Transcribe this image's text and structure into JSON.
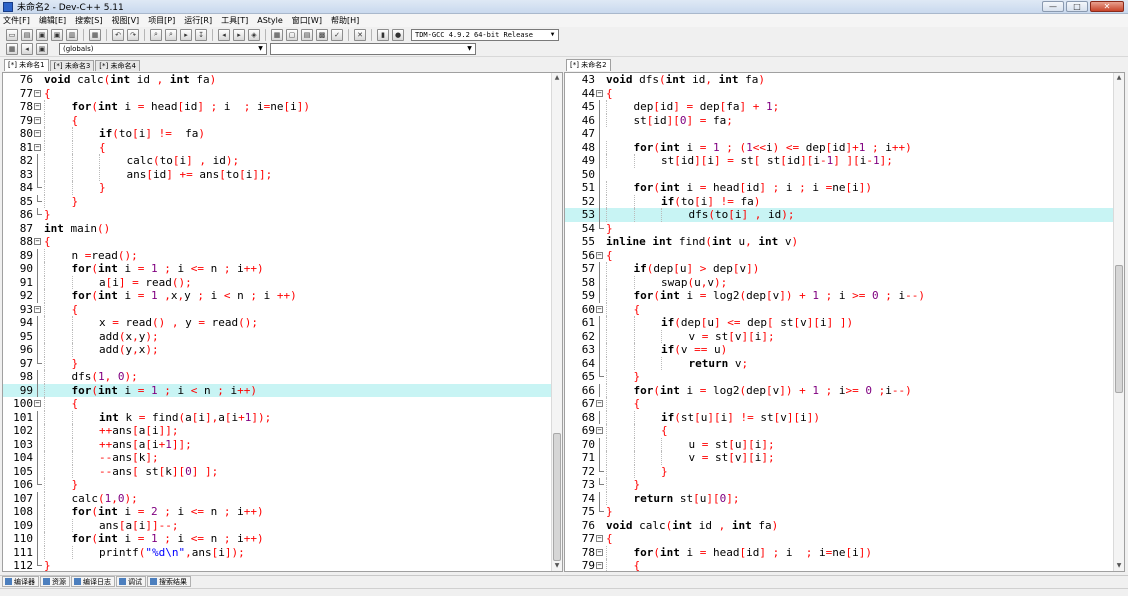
{
  "window": {
    "title": "未命名2 - Dev-C++ 5.11"
  },
  "window_buttons": {
    "minimize": "—",
    "maximize": "□",
    "close": "✕"
  },
  "menu": [
    "文件[F]",
    "编辑[E]",
    "搜索[S]",
    "视图[V]",
    "项目[P]",
    "运行[R]",
    "工具[T]",
    "AStyle",
    "窗口[W]",
    "帮助[H]"
  ],
  "toolbar": {
    "compiler": "TDM-GCC 4.9.2 64-bit Release",
    "scope": "(globals)"
  },
  "left_tabs": [
    "[*] 未命名1",
    "[*] 未命名3",
    "[*] 未命名4"
  ],
  "right_tabs": [
    "[*] 未命名2"
  ],
  "bottom_tabs": [
    "编译器",
    "资源",
    "编译日志",
    "调试",
    "搜索结果"
  ],
  "left_lines": [
    {
      "n": "76",
      "fold": "none",
      "code": "void calc(int id , int fa)",
      "kw": [
        "void",
        "int",
        "int"
      ]
    },
    {
      "n": "77",
      "fold": "open",
      "code": "{"
    },
    {
      "n": "78",
      "fold": "open",
      "code": "    for(int i = head[id] ; i  ; i=ne[i])"
    },
    {
      "n": "79",
      "fold": "open",
      "code": "    {"
    },
    {
      "n": "80",
      "fold": "open",
      "code": "        if(to[i] !=  fa)"
    },
    {
      "n": "81",
      "fold": "open",
      "code": "        {"
    },
    {
      "n": "82",
      "fold": "line",
      "code": "            calc(to[i] , id);"
    },
    {
      "n": "83",
      "fold": "line",
      "code": "            ans[id] += ans[to[i]];"
    },
    {
      "n": "84",
      "fold": "end",
      "code": "        }"
    },
    {
      "n": "85",
      "fold": "end",
      "code": "    }"
    },
    {
      "n": "86",
      "fold": "end",
      "code": "}"
    },
    {
      "n": "87",
      "fold": "none",
      "code": "int main()"
    },
    {
      "n": "88",
      "fold": "open",
      "code": "{"
    },
    {
      "n": "89",
      "fold": "line",
      "code": "    n =read();"
    },
    {
      "n": "90",
      "fold": "line",
      "code": "    for(int i = 1 ; i <= n ; i++)"
    },
    {
      "n": "91",
      "fold": "line",
      "code": "        a[i] = read();"
    },
    {
      "n": "92",
      "fold": "line",
      "code": "    for(int i = 1 ,x,y ; i < n ; i ++)"
    },
    {
      "n": "93",
      "fold": "open",
      "code": "    {"
    },
    {
      "n": "94",
      "fold": "line",
      "code": "        x = read() , y = read();"
    },
    {
      "n": "95",
      "fold": "line",
      "code": "        add(x,y);"
    },
    {
      "n": "96",
      "fold": "line",
      "code": "        add(y,x);"
    },
    {
      "n": "97",
      "fold": "end",
      "code": "    }"
    },
    {
      "n": "98",
      "fold": "line",
      "code": "    dfs(1, 0);"
    },
    {
      "n": "99",
      "fold": "line",
      "code": "    for(int i = 1 ; i < n ; i++)",
      "hl": true
    },
    {
      "n": "100",
      "fold": "open",
      "code": "    {"
    },
    {
      "n": "101",
      "fold": "line",
      "code": "        int k = find(a[i],a[i+1]);"
    },
    {
      "n": "102",
      "fold": "line",
      "code": "        ++ans[a[i]];"
    },
    {
      "n": "103",
      "fold": "line",
      "code": "        ++ans[a[i+1]];"
    },
    {
      "n": "104",
      "fold": "line",
      "code": "        --ans[k];"
    },
    {
      "n": "105",
      "fold": "line",
      "code": "        --ans[ st[k][0] ];"
    },
    {
      "n": "106",
      "fold": "end",
      "code": "    }"
    },
    {
      "n": "107",
      "fold": "line",
      "code": "    calc(1,0);"
    },
    {
      "n": "108",
      "fold": "line",
      "code": "    for(int i = 2 ; i <= n ; i++)"
    },
    {
      "n": "109",
      "fold": "line",
      "code": "        ans[a[i]]--;"
    },
    {
      "n": "110",
      "fold": "line",
      "code": "    for(int i = 1 ; i <= n ; i++)"
    },
    {
      "n": "111",
      "fold": "line",
      "code": "        printf(\"%d\\n\",ans[i]);"
    },
    {
      "n": "112",
      "fold": "end",
      "code": "}"
    }
  ],
  "right_lines": [
    {
      "n": "43",
      "fold": "none",
      "code": "void dfs(int id, int fa)"
    },
    {
      "n": "44",
      "fold": "open",
      "code": "{"
    },
    {
      "n": "45",
      "fold": "line",
      "code": "    dep[id] = dep[fa] + 1;"
    },
    {
      "n": "46",
      "fold": "line",
      "code": "    st[id][0] = fa;"
    },
    {
      "n": "47",
      "fold": "line",
      "code": ""
    },
    {
      "n": "48",
      "fold": "line",
      "code": "    for(int i = 1 ; (1<<i) <= dep[id]+1 ; i++)"
    },
    {
      "n": "49",
      "fold": "line",
      "code": "        st[id][i] = st[ st[id][i-1] ][i-1];"
    },
    {
      "n": "50",
      "fold": "line",
      "code": ""
    },
    {
      "n": "51",
      "fold": "line",
      "code": "    for(int i = head[id] ; i ; i =ne[i])"
    },
    {
      "n": "52",
      "fold": "line",
      "code": "        if(to[i] != fa)"
    },
    {
      "n": "53",
      "fold": "line",
      "code": "            dfs(to[i] , id);",
      "hl": true
    },
    {
      "n": "54",
      "fold": "end",
      "code": "}"
    },
    {
      "n": "55",
      "fold": "none",
      "code": "inline int find(int u, int v)"
    },
    {
      "n": "56",
      "fold": "open",
      "code": "{"
    },
    {
      "n": "57",
      "fold": "line",
      "code": "    if(dep[u] > dep[v])"
    },
    {
      "n": "58",
      "fold": "line",
      "code": "        swap(u,v);"
    },
    {
      "n": "59",
      "fold": "line",
      "code": "    for(int i = log2(dep[v]) + 1 ; i >= 0 ; i--)"
    },
    {
      "n": "60",
      "fold": "open",
      "code": "    {"
    },
    {
      "n": "61",
      "fold": "line",
      "code": "        if(dep[u] <= dep[ st[v][i] ])"
    },
    {
      "n": "62",
      "fold": "line",
      "code": "            v = st[v][i];"
    },
    {
      "n": "63",
      "fold": "line",
      "code": "        if(v == u)"
    },
    {
      "n": "64",
      "fold": "line",
      "code": "            return v;"
    },
    {
      "n": "65",
      "fold": "end",
      "code": "    }"
    },
    {
      "n": "66",
      "fold": "line",
      "code": "    for(int i = log2(dep[v]) + 1 ; i>= 0 ;i--)"
    },
    {
      "n": "67",
      "fold": "open",
      "code": "    {"
    },
    {
      "n": "68",
      "fold": "line",
      "code": "        if(st[u][i] != st[v][i])"
    },
    {
      "n": "69",
      "fold": "open",
      "code": "        {"
    },
    {
      "n": "70",
      "fold": "line",
      "code": "            u = st[u][i];"
    },
    {
      "n": "71",
      "fold": "line",
      "code": "            v = st[v][i];"
    },
    {
      "n": "72",
      "fold": "end",
      "code": "        }"
    },
    {
      "n": "73",
      "fold": "end",
      "code": "    }"
    },
    {
      "n": "74",
      "fold": "line",
      "code": "    return st[u][0];"
    },
    {
      "n": "75",
      "fold": "end",
      "code": "}"
    },
    {
      "n": "76",
      "fold": "none",
      "code": "void calc(int id , int fa)"
    },
    {
      "n": "77",
      "fold": "open",
      "code": "{"
    },
    {
      "n": "78",
      "fold": "open",
      "code": "    for(int i = head[id] ; i  ; i=ne[i])"
    },
    {
      "n": "79",
      "fold": "open",
      "code": "    {"
    }
  ],
  "colors": {
    "highlight_line": "#c8f4f4",
    "symbol": "#ff0000",
    "string": "#0000ff"
  }
}
